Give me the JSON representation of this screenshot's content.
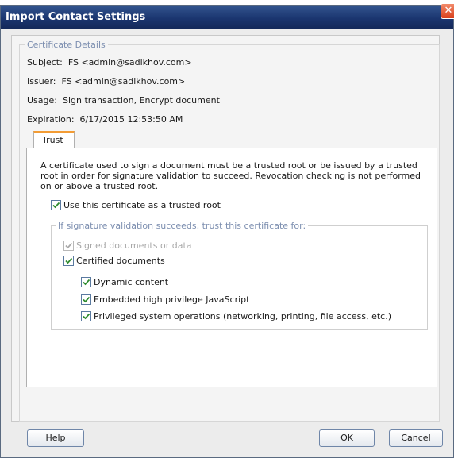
{
  "window": {
    "title": "Import Contact Settings"
  },
  "certificate_details": {
    "legend": "Certificate Details",
    "subject_label": "Subject:",
    "subject_value": "FS <admin@sadikhov.com>",
    "issuer_label": "Issuer:",
    "issuer_value": "FS <admin@sadikhov.com>",
    "usage_label": "Usage:",
    "usage_value": "Sign transaction, Encrypt document",
    "expiration_label": "Expiration:",
    "expiration_value": "6/17/2015 12:53:50 AM"
  },
  "tabs": [
    {
      "label": "Trust",
      "selected": true
    }
  ],
  "trust": {
    "description": "A certificate used to sign a document must be a trusted root or be issued by a trusted root in order for signature validation to succeed.  Revocation checking is not performed on or above a trusted root.",
    "use_trusted_root": {
      "label": "Use this certificate as a trusted root",
      "checked": true
    },
    "group_legend": "If signature validation succeeds, trust this certificate for:",
    "signed_documents": {
      "label": "Signed documents or data",
      "checked": true,
      "disabled": true
    },
    "certified_documents": {
      "label": "Certified documents",
      "checked": true
    },
    "dynamic_content": {
      "label": "Dynamic content",
      "checked": true
    },
    "embedded_js": {
      "label": "Embedded high privilege JavaScript",
      "checked": true
    },
    "privileged_ops": {
      "label": "Privileged system operations (networking, printing, file access, etc.)",
      "checked": true
    }
  },
  "buttons": {
    "help": "Help",
    "ok": "OK",
    "cancel": "Cancel"
  },
  "colors": {
    "titlebar": "#1b3670",
    "tab_accent": "#f39c34",
    "check": "#2e8b2e",
    "legend_text": "#7d8fb0"
  }
}
